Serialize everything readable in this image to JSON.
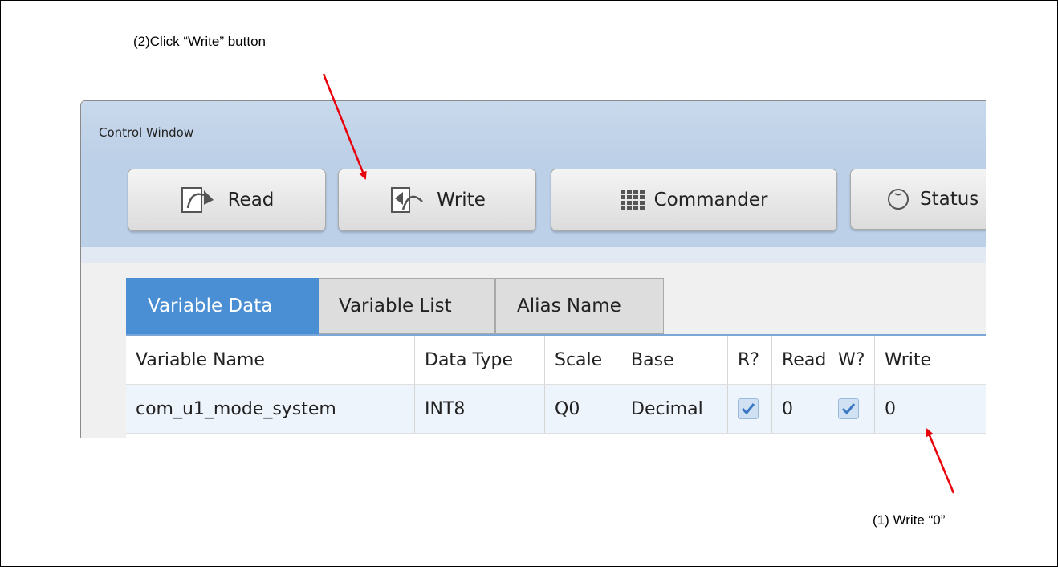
{
  "annotations": {
    "step2": "(2)Click “Write” button",
    "step1": "(1) Write “0”"
  },
  "window": {
    "title": "Control Window"
  },
  "toolbar": {
    "read_label": "Read",
    "write_label": "Write",
    "commander_label": "Commander",
    "status_label": "Status"
  },
  "tabs": [
    {
      "label": "Variable Data",
      "active": true
    },
    {
      "label": "Variable List",
      "active": false
    },
    {
      "label": "Alias Name",
      "active": false
    }
  ],
  "table": {
    "headers": [
      "Variable Name",
      "Data Type",
      "Scale",
      "Base",
      "R?",
      "Read",
      "W?",
      "Write"
    ],
    "rows": [
      {
        "variable_name": "com_u1_mode_system",
        "data_type": "INT8",
        "scale": "Q0",
        "base": "Decimal",
        "r_checked": true,
        "read": "0",
        "w_checked": true,
        "write": "0"
      }
    ]
  },
  "colors": {
    "titlebar": "#c9d9ec",
    "active_tab": "#4a8fd4",
    "arrow": "#e8000b"
  }
}
